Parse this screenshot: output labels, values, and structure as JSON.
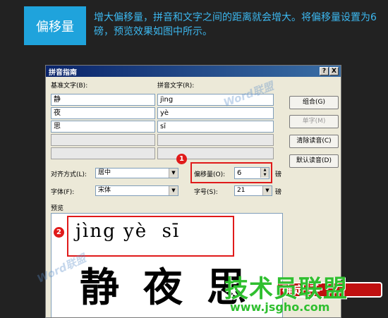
{
  "header": {
    "tag": "偏移量",
    "headline": "增大偏移量，拼音和文字之间的距离就会增大。将偏移量设置为6磅，预览效果如图中所示。"
  },
  "dialog": {
    "title": "拼音指南",
    "help_label": "?",
    "close_label": "X",
    "base_text_label": "基准文字(B):",
    "ruby_text_label": "拼音文字(R):",
    "rows": [
      {
        "base": "静",
        "ruby": "jìng"
      },
      {
        "base": "夜",
        "ruby": "yè"
      },
      {
        "base": "思",
        "ruby": "sī"
      },
      {
        "base": "",
        "ruby": ""
      },
      {
        "base": "",
        "ruby": ""
      }
    ],
    "buttons": {
      "group": "组合(G)",
      "single": "单字(M)",
      "clear": "清除读音(C)",
      "default": "默认读音(D)"
    },
    "align_label": "对齐方式(L):",
    "align_value": "居中",
    "offset_label": "偏移量(O):",
    "offset_value": "6",
    "offset_unit": "磅",
    "font_label": "字体(F):",
    "font_value": "宋体",
    "size_label": "字号(S):",
    "size_value": "21",
    "size_unit": "磅",
    "preview_label": "预览",
    "preview_pinyin": "jìng yè  sī",
    "preview_hanzi": "静夜思"
  },
  "markers": {
    "one": "1",
    "two": "2"
  },
  "overlay": {
    "watermark": "Word联盟",
    "site_logo": "技术员联盟",
    "site_url": "www.jsgho.com",
    "ok_fragment": "确定 手"
  },
  "colors": {
    "accent": "#1fa3dc",
    "marker": "#e01a1a",
    "logo": "#2fbf2f"
  }
}
